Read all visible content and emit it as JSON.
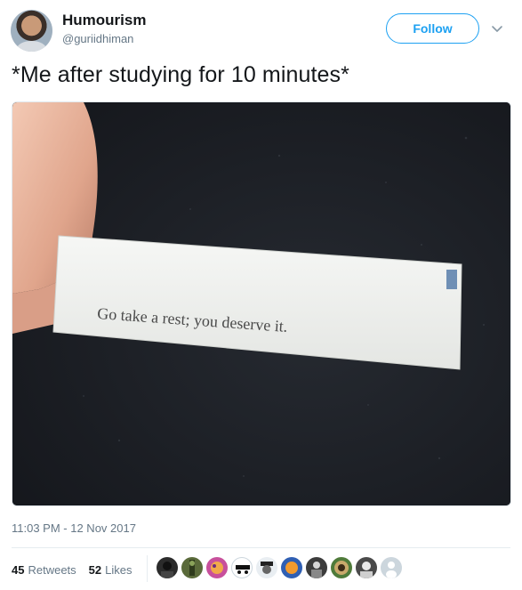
{
  "user": {
    "name": "Humourism",
    "handle": "@guriidhiman"
  },
  "actions": {
    "follow_label": "Follow"
  },
  "tweet": {
    "text": "*Me after studying for 10 minutes*",
    "image_text": "Go take a rest; you deserve it.",
    "timestamp": "11:03 PM - 12 Nov 2017"
  },
  "stats": {
    "retweets_count": "45",
    "retweets_label": "Retweets",
    "likes_count": "52",
    "likes_label": "Likes"
  },
  "likers": [
    {
      "icon": "liker-avatar-1"
    },
    {
      "icon": "liker-avatar-2"
    },
    {
      "icon": "liker-avatar-3"
    },
    {
      "icon": "liker-avatar-4"
    },
    {
      "icon": "liker-avatar-5"
    },
    {
      "icon": "liker-avatar-6"
    },
    {
      "icon": "liker-avatar-7"
    },
    {
      "icon": "liker-avatar-8"
    },
    {
      "icon": "liker-avatar-9"
    }
  ],
  "colors": {
    "accent": "#1da1f2",
    "secondary_text": "#657786",
    "primary_text": "#14171a"
  }
}
